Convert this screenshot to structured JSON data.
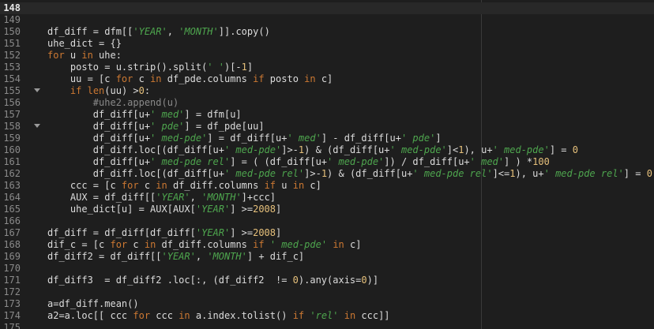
{
  "editor": {
    "current_line": "148",
    "lines": [
      {
        "n": "148",
        "fold": false,
        "tokens": []
      },
      {
        "n": "149",
        "fold": false,
        "tokens": []
      },
      {
        "n": "150",
        "fold": false,
        "tokens": [
          {
            "t": "txt",
            "v": "df_diff = dfm[["
          },
          {
            "t": "str",
            "v": "'YEAR'"
          },
          {
            "t": "txt",
            "v": ", "
          },
          {
            "t": "str",
            "v": "'MONTH'"
          },
          {
            "t": "txt",
            "v": "]].copy()"
          }
        ]
      },
      {
        "n": "151",
        "fold": false,
        "tokens": [
          {
            "t": "txt",
            "v": "uhe_dict = {}"
          }
        ]
      },
      {
        "n": "152",
        "fold": false,
        "tokens": [
          {
            "t": "kw",
            "v": "for"
          },
          {
            "t": "txt",
            "v": " u "
          },
          {
            "t": "kw",
            "v": "in"
          },
          {
            "t": "txt",
            "v": " uhe:"
          }
        ]
      },
      {
        "n": "153",
        "fold": false,
        "tokens": [
          {
            "t": "txt",
            "v": "    posto = u.strip().split("
          },
          {
            "t": "str",
            "v": "' '"
          },
          {
            "t": "txt",
            "v": ")[-"
          },
          {
            "t": "num",
            "v": "1"
          },
          {
            "t": "txt",
            "v": "]"
          }
        ]
      },
      {
        "n": "154",
        "fold": false,
        "tokens": [
          {
            "t": "txt",
            "v": "    uu = [c "
          },
          {
            "t": "kw",
            "v": "for"
          },
          {
            "t": "txt",
            "v": " c "
          },
          {
            "t": "kw",
            "v": "in"
          },
          {
            "t": "txt",
            "v": " df_pde.columns "
          },
          {
            "t": "kw",
            "v": "if"
          },
          {
            "t": "txt",
            "v": " posto "
          },
          {
            "t": "kw",
            "v": "in"
          },
          {
            "t": "txt",
            "v": " c]"
          }
        ]
      },
      {
        "n": "155",
        "fold": true,
        "tokens": [
          {
            "t": "txt",
            "v": "    "
          },
          {
            "t": "kw",
            "v": "if"
          },
          {
            "t": "txt",
            "v": " "
          },
          {
            "t": "kw",
            "v": "len"
          },
          {
            "t": "txt",
            "v": "(uu) >"
          },
          {
            "t": "num",
            "v": "0"
          },
          {
            "t": "txt",
            "v": ":"
          }
        ]
      },
      {
        "n": "156",
        "fold": false,
        "tokens": [
          {
            "t": "com",
            "v": "        #uhe2.append(u)"
          }
        ]
      },
      {
        "n": "157",
        "fold": false,
        "tokens": [
          {
            "t": "txt",
            "v": "        df_diff[u+"
          },
          {
            "t": "str",
            "v": "' med'"
          },
          {
            "t": "txt",
            "v": "] = dfm[u]"
          }
        ]
      },
      {
        "n": "158",
        "fold": true,
        "tokens": [
          {
            "t": "txt",
            "v": "        df_diff[u+"
          },
          {
            "t": "str",
            "v": "' pde'"
          },
          {
            "t": "txt",
            "v": "] = df_pde[uu]"
          }
        ]
      },
      {
        "n": "159",
        "fold": false,
        "tokens": [
          {
            "t": "txt",
            "v": "        df_diff[u+"
          },
          {
            "t": "str",
            "v": "' med-pde'"
          },
          {
            "t": "txt",
            "v": "] = df_diff[u+"
          },
          {
            "t": "str",
            "v": "' med'"
          },
          {
            "t": "txt",
            "v": "] - df_diff[u+"
          },
          {
            "t": "str",
            "v": "' pde'"
          },
          {
            "t": "txt",
            "v": "]"
          }
        ]
      },
      {
        "n": "160",
        "fold": false,
        "tokens": [
          {
            "t": "txt",
            "v": "        df_diff.loc[(df_diff[u+"
          },
          {
            "t": "str",
            "v": "' med-pde'"
          },
          {
            "t": "txt",
            "v": "]>-"
          },
          {
            "t": "num",
            "v": "1"
          },
          {
            "t": "txt",
            "v": ") & (df_diff[u+"
          },
          {
            "t": "str",
            "v": "' med-pde'"
          },
          {
            "t": "txt",
            "v": "]<"
          },
          {
            "t": "num",
            "v": "1"
          },
          {
            "t": "txt",
            "v": "), u+"
          },
          {
            "t": "str",
            "v": "' med-pde'"
          },
          {
            "t": "txt",
            "v": "] = "
          },
          {
            "t": "num",
            "v": "0"
          }
        ]
      },
      {
        "n": "161",
        "fold": false,
        "tokens": [
          {
            "t": "txt",
            "v": "        df_diff[u+"
          },
          {
            "t": "str",
            "v": "' med-pde rel'"
          },
          {
            "t": "txt",
            "v": "] = ( (df_diff[u+"
          },
          {
            "t": "str",
            "v": "' med-pde'"
          },
          {
            "t": "txt",
            "v": "]) / df_diff[u+"
          },
          {
            "t": "str",
            "v": "' med'"
          },
          {
            "t": "txt",
            "v": "] ) *"
          },
          {
            "t": "num",
            "v": "100"
          }
        ]
      },
      {
        "n": "162",
        "fold": false,
        "tokens": [
          {
            "t": "txt",
            "v": "        df_diff.loc[(df_diff[u+"
          },
          {
            "t": "str",
            "v": "' med-pde rel'"
          },
          {
            "t": "txt",
            "v": "]>-"
          },
          {
            "t": "num",
            "v": "1"
          },
          {
            "t": "txt",
            "v": ") & (df_diff[u+"
          },
          {
            "t": "str",
            "v": "' med-pde rel'"
          },
          {
            "t": "txt",
            "v": "]<="
          },
          {
            "t": "num",
            "v": "1"
          },
          {
            "t": "txt",
            "v": "), u+"
          },
          {
            "t": "str",
            "v": "' med-pde rel'"
          },
          {
            "t": "txt",
            "v": "] = "
          },
          {
            "t": "num",
            "v": "0"
          }
        ]
      },
      {
        "n": "163",
        "fold": false,
        "tokens": [
          {
            "t": "txt",
            "v": "    ccc = [c "
          },
          {
            "t": "kw",
            "v": "for"
          },
          {
            "t": "txt",
            "v": " c "
          },
          {
            "t": "kw",
            "v": "in"
          },
          {
            "t": "txt",
            "v": " df_diff.columns "
          },
          {
            "t": "kw",
            "v": "if"
          },
          {
            "t": "txt",
            "v": " u "
          },
          {
            "t": "kw",
            "v": "in"
          },
          {
            "t": "txt",
            "v": " c]"
          }
        ]
      },
      {
        "n": "164",
        "fold": false,
        "tokens": [
          {
            "t": "txt",
            "v": "    AUX = df_diff[["
          },
          {
            "t": "str",
            "v": "'YEAR'"
          },
          {
            "t": "txt",
            "v": ", "
          },
          {
            "t": "str",
            "v": "'MONTH'"
          },
          {
            "t": "txt",
            "v": "]+ccc]"
          }
        ]
      },
      {
        "n": "165",
        "fold": false,
        "tokens": [
          {
            "t": "txt",
            "v": "    uhe_dict[u] = AUX[AUX["
          },
          {
            "t": "str",
            "v": "'YEAR'"
          },
          {
            "t": "txt",
            "v": "] >="
          },
          {
            "t": "num",
            "v": "2008"
          },
          {
            "t": "txt",
            "v": "]"
          }
        ]
      },
      {
        "n": "166",
        "fold": false,
        "tokens": []
      },
      {
        "n": "167",
        "fold": false,
        "tokens": [
          {
            "t": "txt",
            "v": "df_diff = df_diff[df_diff["
          },
          {
            "t": "str",
            "v": "'YEAR'"
          },
          {
            "t": "txt",
            "v": "] >="
          },
          {
            "t": "num",
            "v": "2008"
          },
          {
            "t": "txt",
            "v": "]"
          }
        ]
      },
      {
        "n": "168",
        "fold": false,
        "tokens": [
          {
            "t": "txt",
            "v": "dif_c = [c "
          },
          {
            "t": "kw",
            "v": "for"
          },
          {
            "t": "txt",
            "v": " c "
          },
          {
            "t": "kw",
            "v": "in"
          },
          {
            "t": "txt",
            "v": " df_diff.columns "
          },
          {
            "t": "kw",
            "v": "if"
          },
          {
            "t": "txt",
            "v": " "
          },
          {
            "t": "str",
            "v": "' med-pde'"
          },
          {
            "t": "txt",
            "v": " "
          },
          {
            "t": "kw",
            "v": "in"
          },
          {
            "t": "txt",
            "v": " c]"
          }
        ]
      },
      {
        "n": "169",
        "fold": false,
        "tokens": [
          {
            "t": "txt",
            "v": "df_diff2 = df_diff[["
          },
          {
            "t": "str",
            "v": "'YEAR'"
          },
          {
            "t": "txt",
            "v": ", "
          },
          {
            "t": "str",
            "v": "'MONTH'"
          },
          {
            "t": "txt",
            "v": "] + dif_c]"
          }
        ]
      },
      {
        "n": "170",
        "fold": false,
        "tokens": []
      },
      {
        "n": "171",
        "fold": false,
        "tokens": [
          {
            "t": "txt",
            "v": "df_diff3  = df_diff2 .loc[:, (df_diff2  != "
          },
          {
            "t": "num",
            "v": "0"
          },
          {
            "t": "txt",
            "v": ").any(axis="
          },
          {
            "t": "num",
            "v": "0"
          },
          {
            "t": "txt",
            "v": ")]"
          }
        ]
      },
      {
        "n": "172",
        "fold": false,
        "tokens": []
      },
      {
        "n": "173",
        "fold": false,
        "tokens": [
          {
            "t": "txt",
            "v": "a=df_diff.mean()"
          }
        ]
      },
      {
        "n": "174",
        "fold": false,
        "tokens": [
          {
            "t": "txt",
            "v": "a2=a.loc[[ ccc "
          },
          {
            "t": "kw",
            "v": "for"
          },
          {
            "t": "txt",
            "v": " ccc "
          },
          {
            "t": "kw",
            "v": "in"
          },
          {
            "t": "txt",
            "v": " a.index.tolist() "
          },
          {
            "t": "kw",
            "v": "if"
          },
          {
            "t": "txt",
            "v": " "
          },
          {
            "t": "str",
            "v": "'rel'"
          },
          {
            "t": "txt",
            "v": " "
          },
          {
            "t": "kw",
            "v": "in"
          },
          {
            "t": "txt",
            "v": " ccc]]"
          }
        ]
      },
      {
        "n": "175",
        "fold": false,
        "tokens": []
      }
    ]
  }
}
